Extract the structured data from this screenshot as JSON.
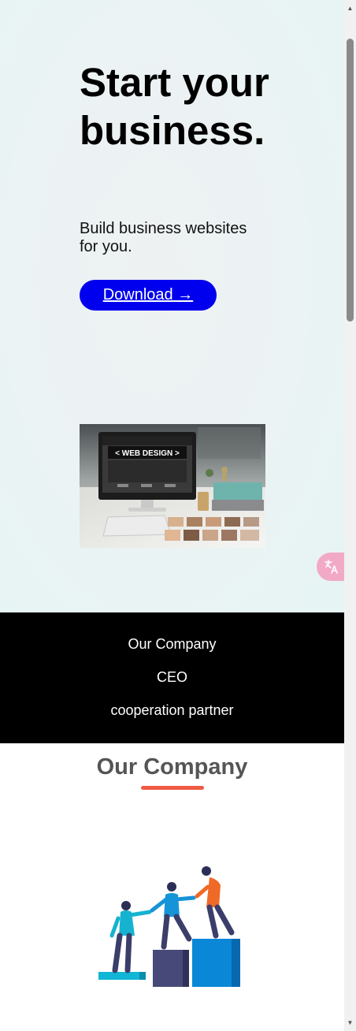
{
  "hero": {
    "title": "Start your business.",
    "subtitle": "Build business websites for you.",
    "download_label": "Download →",
    "image_text": "< WEB DESIGN >"
  },
  "translate": {
    "icon": "translate-icon"
  },
  "nav": {
    "items": [
      "Our Company",
      "CEO",
      "cooperation partner"
    ]
  },
  "company": {
    "title": "Our Company",
    "accent_color": "#ef5b45"
  },
  "colors": {
    "button": "#0000ee",
    "nav_bg": "#000000",
    "hero_bg": "#ebf3f4"
  },
  "scrollbar": {
    "up": "▲",
    "down": "▼",
    "position": 0
  }
}
